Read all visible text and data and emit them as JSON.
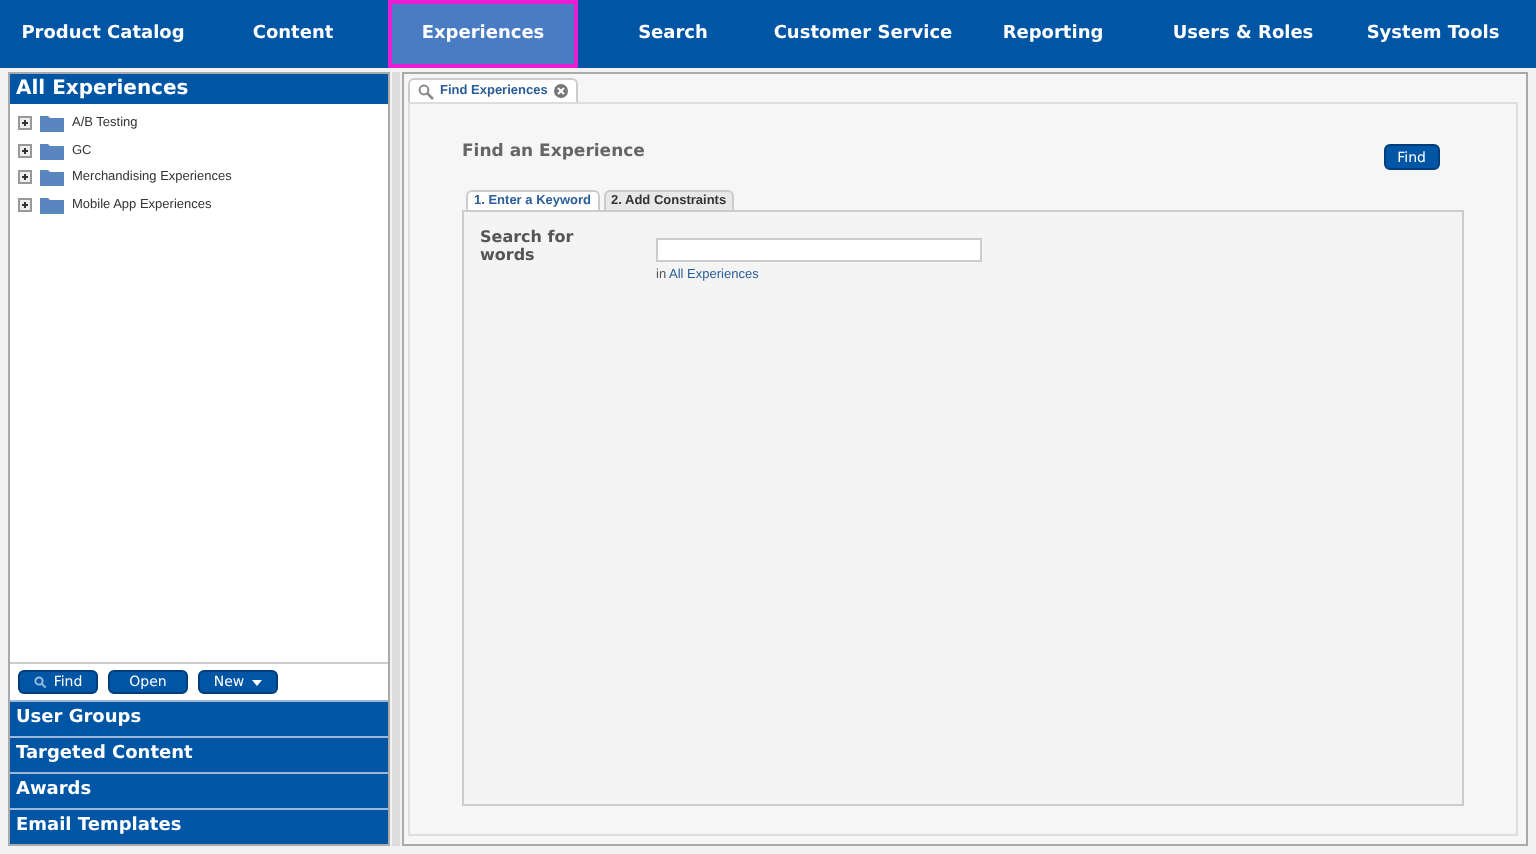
{
  "nav": [
    {
      "label": "Product Catalog",
      "selected": false
    },
    {
      "label": "Content",
      "selected": false
    },
    {
      "label": "Experiences",
      "selected": true
    },
    {
      "label": "Search",
      "selected": false
    },
    {
      "label": "Customer Service",
      "selected": false
    },
    {
      "label": "Reporting",
      "selected": false
    },
    {
      "label": "Users & Roles",
      "selected": false
    },
    {
      "label": "System Tools",
      "selected": false
    }
  ],
  "sidebar": {
    "title": "All Experiences",
    "tree": [
      {
        "label": "A/B Testing",
        "expanded": false
      },
      {
        "label": "GC",
        "expanded": false
      },
      {
        "label": "Merchandising Experiences",
        "expanded": false
      },
      {
        "label": "Mobile App Experiences",
        "expanded": false
      }
    ],
    "buttons": [
      {
        "label": "Find",
        "kind": "search"
      },
      {
        "label": "Open",
        "kind": "plain"
      },
      {
        "label": "New",
        "kind": "dropdown"
      }
    ],
    "sections": [
      "User Groups",
      "Targeted Content",
      "Awards",
      "Email Templates"
    ]
  },
  "main": {
    "tab": "Find Experiences",
    "heading": "Find an Experience",
    "find_button": "Find",
    "steps": [
      {
        "label": "1. Enter a Keyword",
        "selected": true
      },
      {
        "label": "2. Add Constraints",
        "selected": false
      }
    ],
    "search_label": "Search for words",
    "scope_prefix": "in",
    "scope_link": "All Experiences"
  }
}
